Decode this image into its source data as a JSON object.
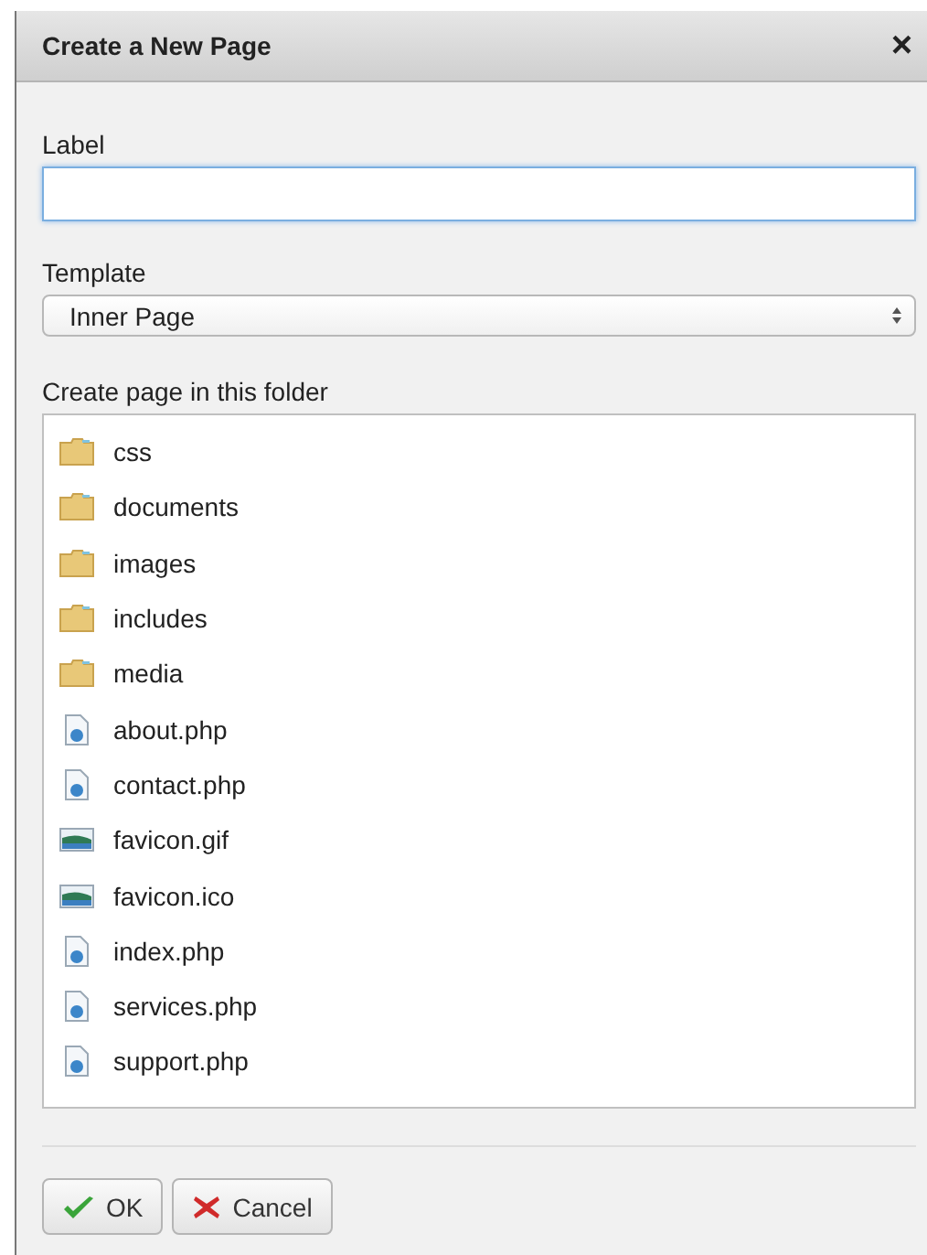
{
  "dialog": {
    "title": "Create a New Page",
    "close": "×"
  },
  "label_field": {
    "label": "Label",
    "focused": true
  },
  "template": {
    "label": "Template",
    "value": "Inner Page"
  },
  "folder_list": {
    "label": "Create page in this folder",
    "items": [
      {
        "name": "css",
        "kind": "folder"
      },
      {
        "name": "documents",
        "kind": "folder"
      },
      {
        "name": "images",
        "kind": "folder"
      },
      {
        "name": "includes",
        "kind": "folder"
      },
      {
        "name": "media",
        "kind": "folder"
      },
      {
        "name": "about.php",
        "kind": "script"
      },
      {
        "name": "contact.php",
        "kind": "script"
      },
      {
        "name": "favicon.gif",
        "kind": "image"
      },
      {
        "name": "favicon.ico",
        "kind": "image"
      },
      {
        "name": "index.php",
        "kind": "script"
      },
      {
        "name": "services.php",
        "kind": "script"
      },
      {
        "name": "support.php",
        "kind": "script"
      }
    ]
  },
  "buttons": [
    {
      "label": "OK",
      "kind": "ok"
    },
    {
      "label": "Cancel",
      "kind": "cancel"
    }
  ]
}
